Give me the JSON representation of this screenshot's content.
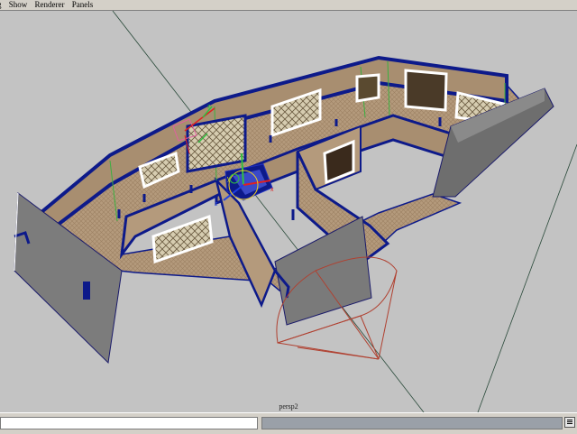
{
  "menu": {
    "items": [
      "g",
      "Show",
      "Renderer",
      "Panels"
    ]
  },
  "viewport": {
    "camera_label": "persp2"
  },
  "statusbar": {
    "command_value": "",
    "feedback_value": ""
  },
  "colors": {
    "viewport_bg": "#c3c3c3",
    "floor": "#b49a7c",
    "wall_trim": "#0d1a8a",
    "panel_grey": "#7c7c7c",
    "camera_frustum": "#b04030"
  }
}
